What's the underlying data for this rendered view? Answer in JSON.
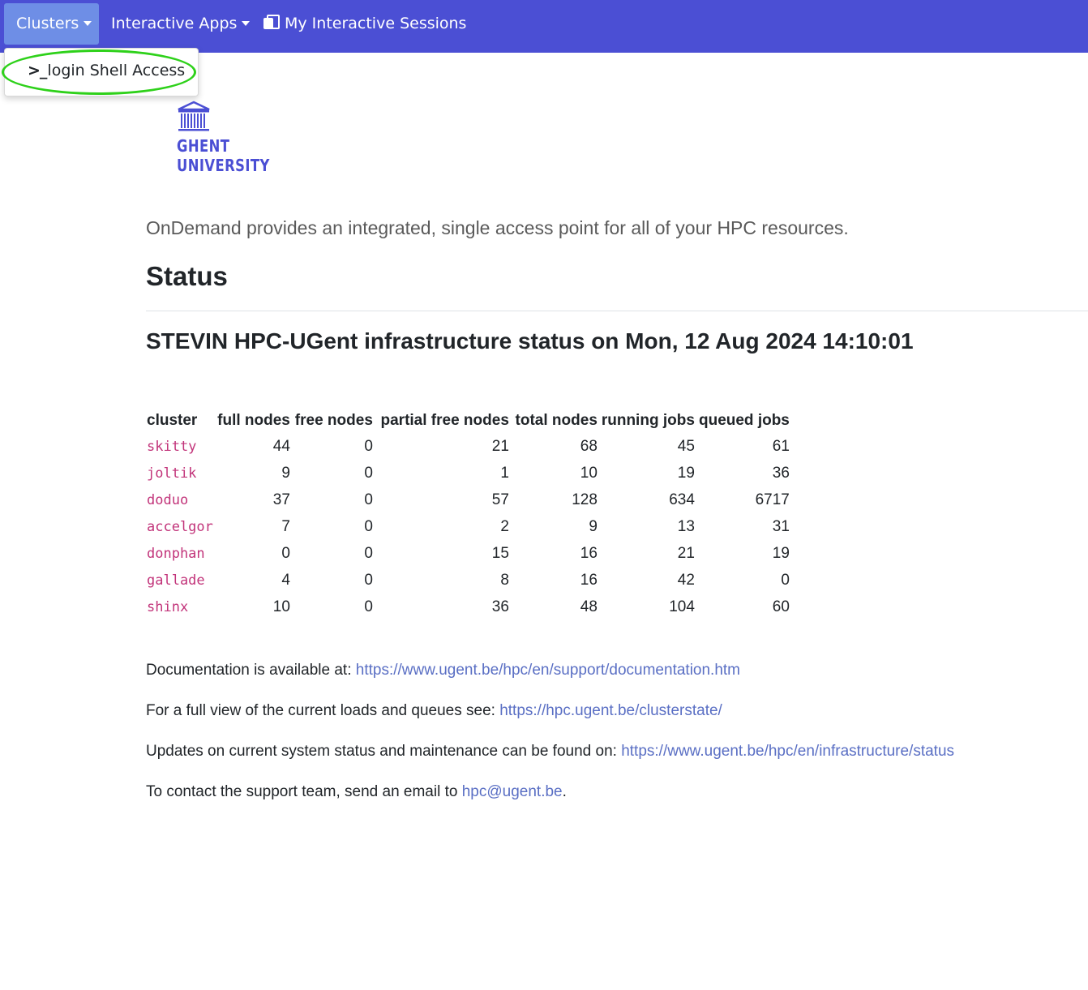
{
  "navbar": {
    "clusters_label": "Clusters",
    "interactive_apps_label": "Interactive Apps",
    "sessions_label": "My Interactive Sessions"
  },
  "dropdown": {
    "item_label": "login Shell Access",
    "terminal_glyph": ">_"
  },
  "logo": {
    "line1": "GHENT",
    "line2": "UNIVERSITY"
  },
  "lead": "OnDemand provides an integrated, single access point for all of your HPC resources.",
  "status_heading": "Status",
  "infra_heading": "STEVIN HPC-UGent infrastructure status on Mon, 12 Aug 2024 14:10:01",
  "table": {
    "headers": [
      "cluster",
      "full nodes",
      "free nodes",
      "partial free nodes",
      "total nodes",
      "running jobs",
      "queued jobs"
    ],
    "rows": [
      [
        "skitty",
        "44",
        "0",
        "21",
        "68",
        "45",
        "61"
      ],
      [
        "joltik",
        "9",
        "0",
        "1",
        "10",
        "19",
        "36"
      ],
      [
        "doduo",
        "37",
        "0",
        "57",
        "128",
        "634",
        "6717"
      ],
      [
        "accelgor",
        "7",
        "0",
        "2",
        "9",
        "13",
        "31"
      ],
      [
        "donphan",
        "0",
        "0",
        "15",
        "16",
        "21",
        "19"
      ],
      [
        "gallade",
        "4",
        "0",
        "8",
        "16",
        "42",
        "0"
      ],
      [
        "shinx",
        "10",
        "0",
        "36",
        "48",
        "104",
        "60"
      ]
    ]
  },
  "info": {
    "doc_text": "Documentation is available at: ",
    "doc_link": "https://www.ugent.be/hpc/en/support/documentation.htm",
    "loads_text": "For a full view of the current loads and queues see: ",
    "loads_link": "https://hpc.ugent.be/clusterstate/",
    "updates_text": "Updates on current system status and maintenance can be found on: ",
    "updates_link": "https://www.ugent.be/hpc/en/infrastructure/status",
    "contact_text": "To contact the support team, send an email to ",
    "contact_link": "hpc@ugent.be",
    "contact_suffix": "."
  },
  "colors": {
    "navbar": "#4b4fd4",
    "active_nav": "#6e8ee6",
    "cluster_name": "#c2347a",
    "link": "#5a6fc4",
    "highlight": "#2ed11a"
  }
}
